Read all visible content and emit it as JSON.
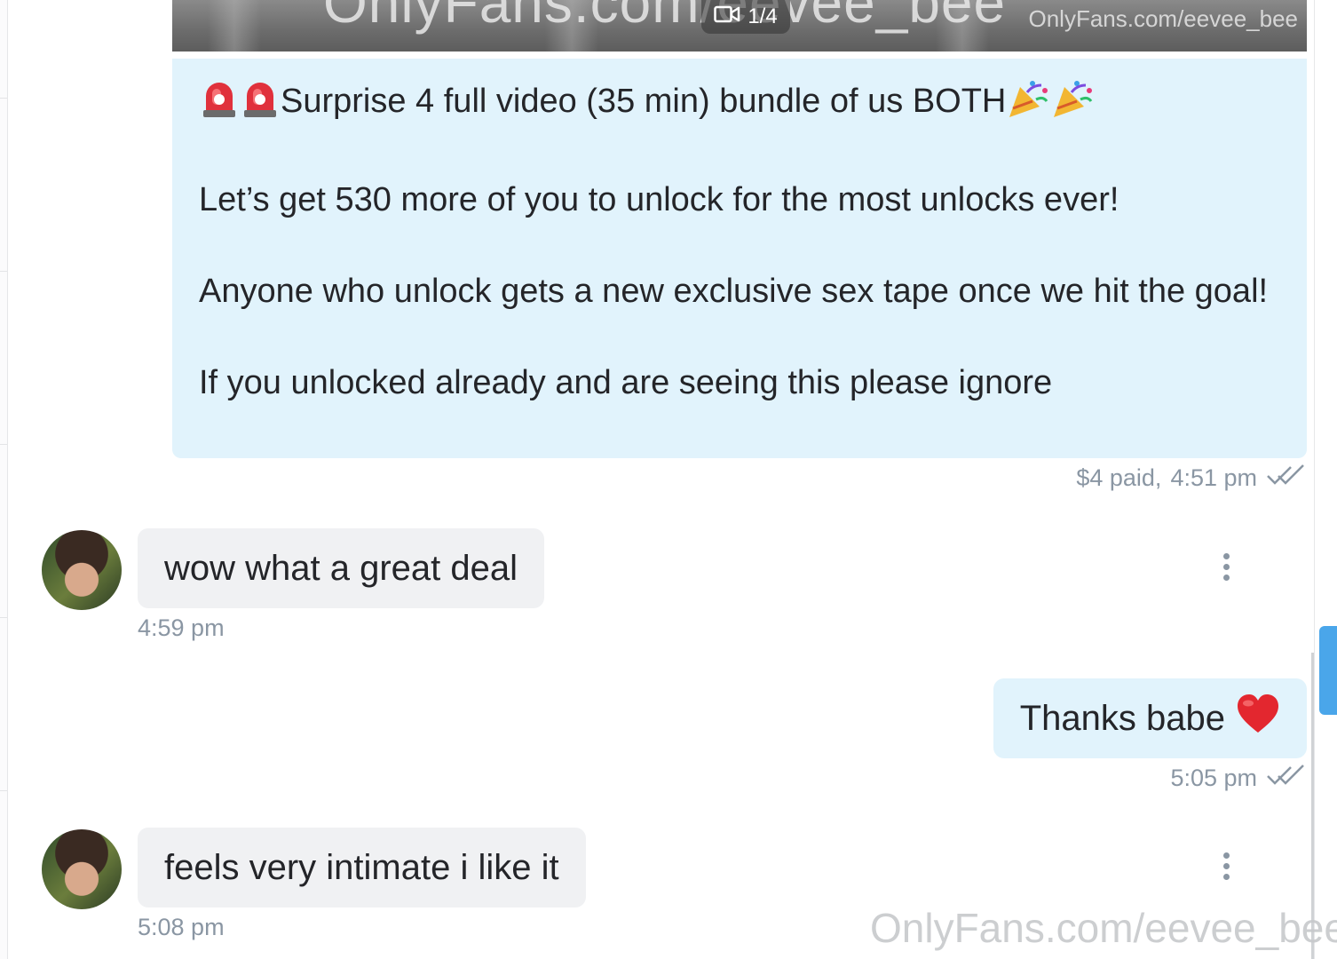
{
  "media_post": {
    "counter": "1/4",
    "watermark_big": "OnlyFans.com/eevee_bee",
    "watermark_small": "OnlyFans.com/eevee_bee",
    "line1": "Surprise 4 full video (35 min) bundle of us BOTH",
    "line2": "Let’s get 530 more of you to unlock for the most unlocks ever!",
    "line3": "Anyone who unlock gets a new exclusive sex tape once we hit the goal!",
    "line4": "If you unlocked already and are seeing this please ignore",
    "leading_emoji": "siren-emoji",
    "trailing_emoji": "party-popper-emoji",
    "meta_price": "$4 paid,",
    "meta_time": "4:51 pm"
  },
  "messages": [
    {
      "direction": "incoming",
      "text": "wow what a great deal",
      "time": "4:59 pm"
    },
    {
      "direction": "outgoing",
      "text": "Thanks babe",
      "emoji": "red-heart-emoji",
      "time": "5:05 pm"
    },
    {
      "direction": "incoming",
      "text": "feels very intimate i like it",
      "time": "5:08 pm"
    }
  ],
  "footer_watermark": "OnlyFans.com/eevee_bee",
  "colors": {
    "outgoing_bubble": "#e1f3fc",
    "incoming_bubble": "#f0f1f3",
    "meta_text": "#8a96a3",
    "scroll_thumb": "#4aa6ea"
  }
}
